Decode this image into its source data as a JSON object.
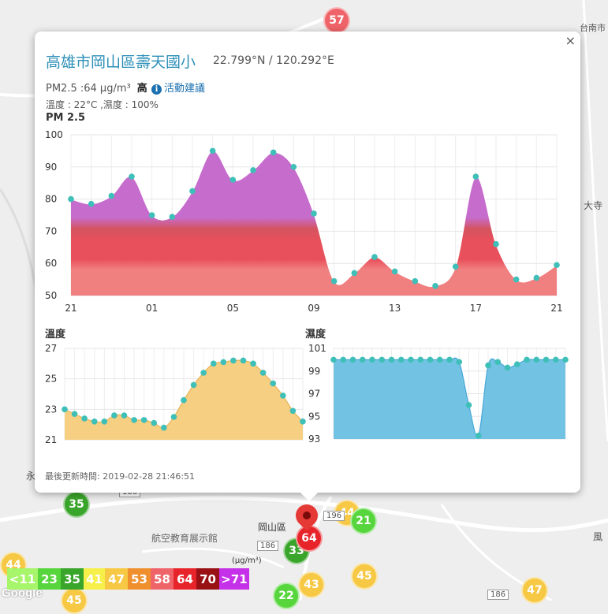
{
  "popup": {
    "title": "高雄市岡山區壽天國小",
    "coords": "22.799°N / 120.292°E",
    "pm_label": "PM2.5 :64 μg/m³",
    "pm_level": "高",
    "advice_label": "活動建議",
    "weather": "溫度 : 22°C ,濕度 : 100%",
    "close_label": "×",
    "updated": "最後更新時間: 2019-02-28 21:46:51"
  },
  "pm_chart": {
    "title": "PM 2.5",
    "ylim": [
      50,
      100
    ],
    "yticks": [
      "100",
      "90",
      "80",
      "70",
      "60",
      "50"
    ],
    "xticks": [
      "21",
      "01",
      "05",
      "09",
      "13",
      "17",
      "21"
    ],
    "xtick_index": [
      0,
      4,
      8,
      12,
      16,
      20,
      24
    ],
    "colors": {
      "band_high": "#c66ccc",
      "band_mid": "#e8505b",
      "band_low": "#f08080",
      "point": "#3ebfb8"
    }
  },
  "temp_chart": {
    "title": "溫度",
    "ylim": [
      21,
      27
    ],
    "yticks": [
      "27",
      "25",
      "23",
      "21"
    ],
    "colors": {
      "fill": "#f6cf82",
      "line": "#e7b35a",
      "point": "#3ebfb8"
    }
  },
  "hum_chart": {
    "title": "濕度",
    "ylim": [
      93,
      101
    ],
    "yticks": [
      "101",
      "99",
      "97",
      "95",
      "93"
    ],
    "colors": {
      "fill": "#72c2e4",
      "line": "#4aa8d8",
      "point": "#3ebfb8"
    }
  },
  "chart_data": [
    {
      "type": "area",
      "title": "PM 2.5",
      "x": [
        "21",
        "22",
        "23",
        "00",
        "01",
        "02",
        "03",
        "04",
        "05",
        "06",
        "07",
        "08",
        "09",
        "10",
        "11",
        "12",
        "13",
        "14",
        "15",
        "16",
        "17",
        "18",
        "19",
        "20",
        "21"
      ],
      "values": [
        80,
        78.5,
        81,
        87,
        75,
        74.5,
        82.5,
        95,
        86,
        89,
        94.5,
        90,
        75.5,
        54.5,
        57,
        62,
        57.5,
        54.5,
        53,
        59,
        87,
        66,
        55,
        55.5,
        59.5
      ],
      "ylim": [
        50,
        100
      ],
      "grid": true
    },
    {
      "type": "area",
      "title": "溫度",
      "values": [
        23,
        22.7,
        22.4,
        22.2,
        22.2,
        22.6,
        22.6,
        22.3,
        22.3,
        22.1,
        21.8,
        22.5,
        23.6,
        24.6,
        25.4,
        26,
        26.1,
        26.2,
        26.2,
        26,
        25.4,
        24.7,
        23.9,
        22.9,
        22.2
      ],
      "ylim": [
        21,
        27
      ],
      "grid": true
    },
    {
      "type": "area",
      "title": "濕度",
      "values": [
        100,
        100,
        100,
        100,
        100,
        100,
        100,
        100,
        100,
        100,
        100,
        100,
        100,
        99.8,
        96,
        93.3,
        99.5,
        99.8,
        99.3,
        99.6,
        100,
        100,
        100,
        100,
        100
      ],
      "ylim": [
        93,
        101
      ],
      "grid": true
    }
  ],
  "map": {
    "markers": [
      "57",
      "35",
      "44",
      "21",
      "33",
      "64",
      "44",
      "43",
      "45",
      "47",
      "22",
      "45"
    ],
    "labels": [
      "岡山區",
      "航空教育展示館",
      "永",
      "台南市",
      "風",
      "大寺",
      "186",
      "186",
      "186",
      "196"
    ],
    "google": "Google"
  },
  "legend": {
    "unit": "(μg/m³)",
    "items": [
      {
        "label": "<11",
        "color": "#a6f56a"
      },
      {
        "label": "23",
        "color": "#57d53c"
      },
      {
        "label": "35",
        "color": "#3aa52b"
      },
      {
        "label": "41",
        "color": "#f7ef4a"
      },
      {
        "label": "47",
        "color": "#f6c843"
      },
      {
        "label": "53",
        "color": "#f08f2e"
      },
      {
        "label": "58",
        "color": "#ef6469"
      },
      {
        "label": "64",
        "color": "#e8242b"
      },
      {
        "label": "70",
        "color": "#991015"
      },
      {
        "label": ">71",
        "color": "#c531e8"
      }
    ]
  }
}
